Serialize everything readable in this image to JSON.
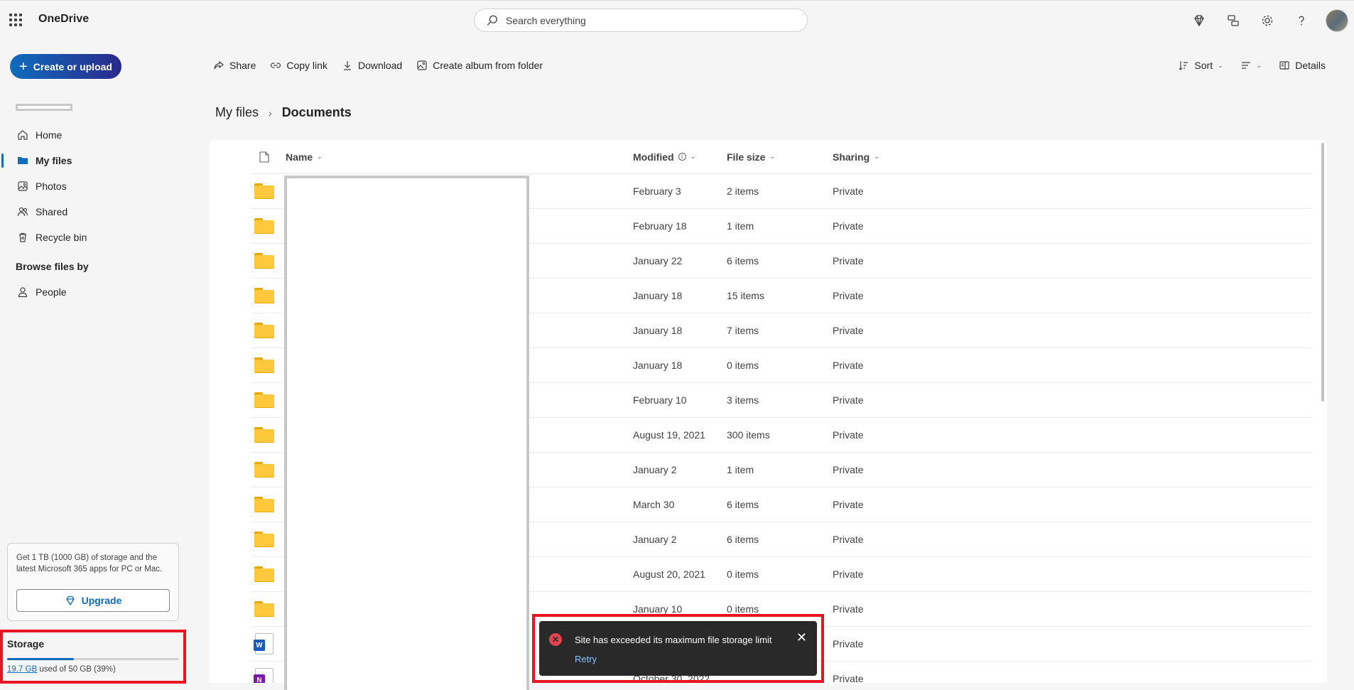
{
  "app": {
    "title": "OneDrive"
  },
  "search": {
    "placeholder": "Search everything"
  },
  "create_button": {
    "label": "Create or upload"
  },
  "nav": {
    "items": [
      {
        "label": "Home",
        "icon": "home-icon"
      },
      {
        "label": "My files",
        "icon": "folder-icon",
        "active": true
      },
      {
        "label": "Photos",
        "icon": "photos-icon"
      },
      {
        "label": "Shared",
        "icon": "people-icon"
      },
      {
        "label": "Recycle bin",
        "icon": "trash-icon"
      }
    ],
    "browse_heading": "Browse files by",
    "browse_items": [
      {
        "label": "People",
        "icon": "person-icon"
      }
    ]
  },
  "promo": {
    "text": "Get 1 TB (1000 GB) of storage and the latest Microsoft 365 apps for PC or Mac.",
    "upgrade_label": "Upgrade"
  },
  "storage": {
    "title": "Storage",
    "used": "19.7 GB",
    "suffix": " used of 50 GB (39%)",
    "percent": 39
  },
  "commands": {
    "share": "Share",
    "copy_link": "Copy link",
    "download": "Download",
    "create_album": "Create album from folder",
    "sort": "Sort",
    "details": "Details"
  },
  "breadcrumb": {
    "parent": "My files",
    "current": "Documents"
  },
  "table": {
    "headers": {
      "name": "Name",
      "modified": "Modified",
      "file_size": "File size",
      "sharing": "Sharing"
    },
    "rows": [
      {
        "type": "folder",
        "modified": "February 3",
        "size": "2 items",
        "sharing": "Private"
      },
      {
        "type": "folder",
        "modified": "February 18",
        "size": "1 item",
        "sharing": "Private"
      },
      {
        "type": "folder",
        "modified": "January 22",
        "size": "6 items",
        "sharing": "Private"
      },
      {
        "type": "folder",
        "modified": "January 18",
        "size": "15 items",
        "sharing": "Private"
      },
      {
        "type": "folder",
        "modified": "January 18",
        "size": "7 items",
        "sharing": "Private"
      },
      {
        "type": "folder",
        "modified": "January 18",
        "size": "0 items",
        "sharing": "Private"
      },
      {
        "type": "folder",
        "modified": "February 10",
        "size": "3 items",
        "sharing": "Private"
      },
      {
        "type": "folder",
        "modified": "August 19, 2021",
        "size": "300 items",
        "sharing": "Private"
      },
      {
        "type": "folder",
        "modified": "January 2",
        "size": "1 item",
        "sharing": "Private"
      },
      {
        "type": "folder",
        "modified": "March 30",
        "size": "6 items",
        "sharing": "Private"
      },
      {
        "type": "folder",
        "modified": "January 2",
        "size": "6 items",
        "sharing": "Private"
      },
      {
        "type": "folder",
        "modified": "August 20, 2021",
        "size": "0 items",
        "sharing": "Private"
      },
      {
        "type": "folder",
        "modified": "January 10",
        "size": "0 items",
        "sharing": "Private"
      },
      {
        "type": "word",
        "modified": "",
        "size": "",
        "sharing": "Private"
      },
      {
        "type": "onenote",
        "modified": "October 30, 2022",
        "size": "",
        "sharing": "Private"
      }
    ]
  },
  "toast": {
    "message": "Site has exceeded its maximum file storage limit",
    "action": "Retry"
  },
  "colors": {
    "accent": "#0f6cbd",
    "highlight": "#e8141f",
    "folder": "#ffc83d",
    "error": "#e0454f"
  }
}
